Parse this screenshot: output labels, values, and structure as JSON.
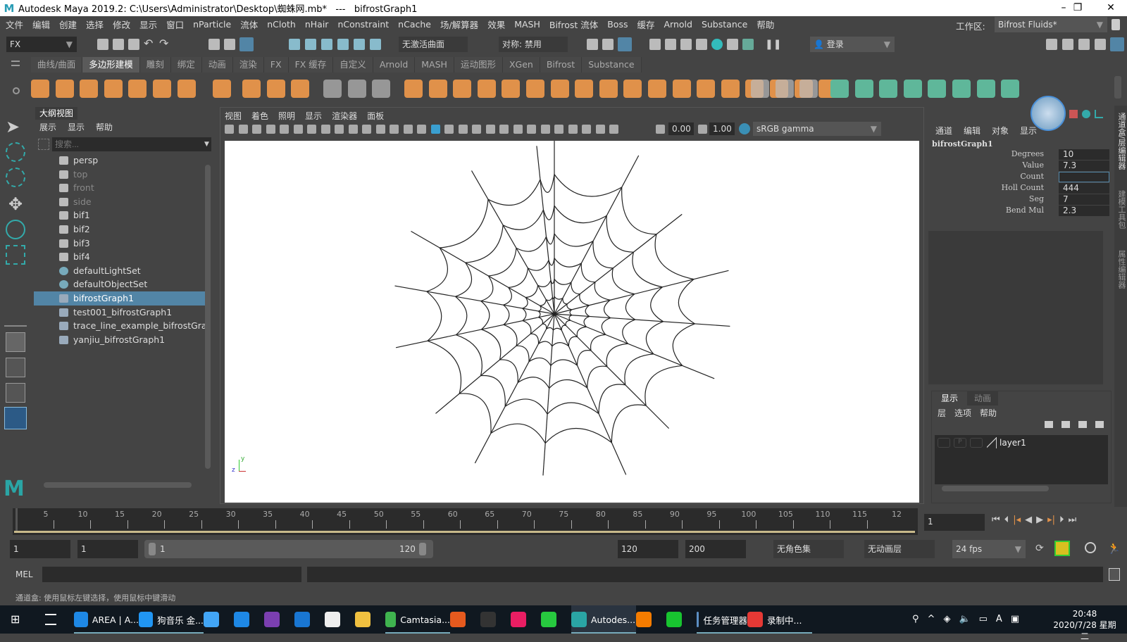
{
  "window": {
    "title": "Autodesk Maya 2019.2: C:\\Users\\Administrator\\Desktop\\蜘蛛网.mb*   ---   bifrostGraph1",
    "minimize": "–",
    "maximize": "❐",
    "close": "✕"
  },
  "menubar": [
    "文件",
    "编辑",
    "创建",
    "选择",
    "修改",
    "显示",
    "窗口",
    "nParticle",
    "流体",
    "nCloth",
    "nHair",
    "nConstraint",
    "nCache",
    "场/解算器",
    "效果",
    "MASH",
    "Bifrost 流体",
    "Boss",
    "缓存",
    "Arnold",
    "Substance",
    "帮助"
  ],
  "workspace": {
    "label": "工作区:",
    "value": "Bifrost Fluids*"
  },
  "toolbar": {
    "menuset": "FX",
    "live_surface": "无激活曲面",
    "symmetry": "对称: 禁用",
    "login": "登录"
  },
  "shelf_tabs": [
    "曲线/曲面",
    "多边形建模",
    "雕刻",
    "绑定",
    "动画",
    "渲染",
    "FX",
    "FX 缓存",
    "自定义",
    "Arnold",
    "MASH",
    "运动图形",
    "XGen",
    "Bifrost",
    "Substance"
  ],
  "shelf_active": 1,
  "shelf_colors": {
    "orange": "#e0914a",
    "teal": "#5fb79a",
    "gray": "#bbbbbb"
  },
  "outliner": {
    "tab": "大纲视图",
    "menus": [
      "展示",
      "显示",
      "帮助"
    ],
    "search_placeholder": "搜索...",
    "items": [
      {
        "label": "persp",
        "icon": "camera-icon",
        "dim": false
      },
      {
        "label": "top",
        "icon": "camera-icon",
        "dim": true
      },
      {
        "label": "front",
        "icon": "camera-icon",
        "dim": true
      },
      {
        "label": "side",
        "icon": "camera-icon",
        "dim": true
      },
      {
        "label": "bif1",
        "icon": "bifrost-object-icon"
      },
      {
        "label": "bif2",
        "icon": "bifrost-object-icon"
      },
      {
        "label": "bif3",
        "icon": "bifrost-object-icon"
      },
      {
        "label": "bif4",
        "icon": "bifrost-object-icon"
      },
      {
        "label": "defaultLightSet",
        "icon": "set-icon"
      },
      {
        "label": "defaultObjectSet",
        "icon": "set-icon"
      },
      {
        "label": "bifrostGraph1",
        "icon": "bifrost-graph-icon",
        "selected": true
      },
      {
        "label": "test001_bifrostGraph1",
        "icon": "bifrost-graph-icon"
      },
      {
        "label": "trace_line_example_bifrostGraph1",
        "icon": "bifrost-graph-icon"
      },
      {
        "label": "yanjiu_bifrostGraph1",
        "icon": "bifrost-graph-icon"
      }
    ]
  },
  "viewport": {
    "menus": [
      "视图",
      "着色",
      "照明",
      "显示",
      "渲染器",
      "面板"
    ],
    "exposure": "0.00",
    "gamma": "1.00",
    "color_space": "sRGB gamma",
    "axis_y": "y",
    "axis_z": "z"
  },
  "channel_box": {
    "menus": [
      "通道",
      "编辑",
      "对象",
      "显示"
    ],
    "node": "bifrostGraph1",
    "attrs": [
      {
        "name": "Degrees",
        "value": "10"
      },
      {
        "name": "Value",
        "value": "7.3"
      },
      {
        "name": "Count",
        "value": ""
      },
      {
        "name": "Holl Count",
        "value": "444"
      },
      {
        "name": "Seg",
        "value": "7"
      },
      {
        "name": "Bend Mul",
        "value": "2.3"
      }
    ]
  },
  "right_tabs": [
    "通道盒/层编辑器",
    "建模工具包",
    "属性编辑器"
  ],
  "layer_editor": {
    "tabs": [
      "显示",
      "动画"
    ],
    "menus": [
      "层",
      "选项",
      "帮助"
    ],
    "layer": "layer1",
    "p_label": "P"
  },
  "timeline": {
    "start": 1,
    "end": 120,
    "current": 1,
    "ticks": [
      "5",
      "10",
      "15",
      "20",
      "25",
      "30",
      "35",
      "40",
      "45",
      "50",
      "55",
      "60",
      "65",
      "70",
      "75",
      "80",
      "85",
      "90",
      "95",
      "100",
      "105",
      "110",
      "115",
      "12"
    ],
    "current_field": "1"
  },
  "range": {
    "start": "1",
    "anim_start": "1",
    "range_start": "1",
    "range_end": "120",
    "end": "120",
    "anim_end": "200",
    "character_set": "无角色集",
    "anim_layer": "无动画层",
    "fps": "24 fps"
  },
  "mel": {
    "label": "MEL"
  },
  "status": "通道盒: 使用鼠标左键选择，使用鼠标中键滑动",
  "taskbar": {
    "items": [
      {
        "label": "AREA | A...",
        "color": "#1e88e5"
      },
      {
        "label": "狗音乐 金...",
        "color": "#2196f3"
      },
      {
        "label": "",
        "color": "#42a5f5"
      },
      {
        "label": "",
        "color": "#1e88e5"
      },
      {
        "label": "",
        "color": "#7b3fb0"
      },
      {
        "label": "",
        "color": "#1976d2"
      },
      {
        "label": "",
        "color": "#eeeeee"
      },
      {
        "label": "",
        "color": "#f0c040"
      },
      {
        "label": "Camtasia...",
        "color": "#3fb34f"
      },
      {
        "label": "",
        "color": "#e65a1e"
      },
      {
        "label": "",
        "color": "#333333"
      },
      {
        "label": "",
        "color": "#e91e63"
      },
      {
        "label": "",
        "color": "#27c93f"
      },
      {
        "label": "Autodes...",
        "color": "#2aa5a5"
      },
      {
        "label": "",
        "color": "#f57c00"
      },
      {
        "label": "",
        "color": "#18c430"
      },
      {
        "label": "任务管理器",
        "color": "#5c8fc4"
      },
      {
        "label": "录制中...",
        "color": "#e53935"
      }
    ],
    "time": "20:48",
    "date": "2020/7/28 星期二"
  }
}
